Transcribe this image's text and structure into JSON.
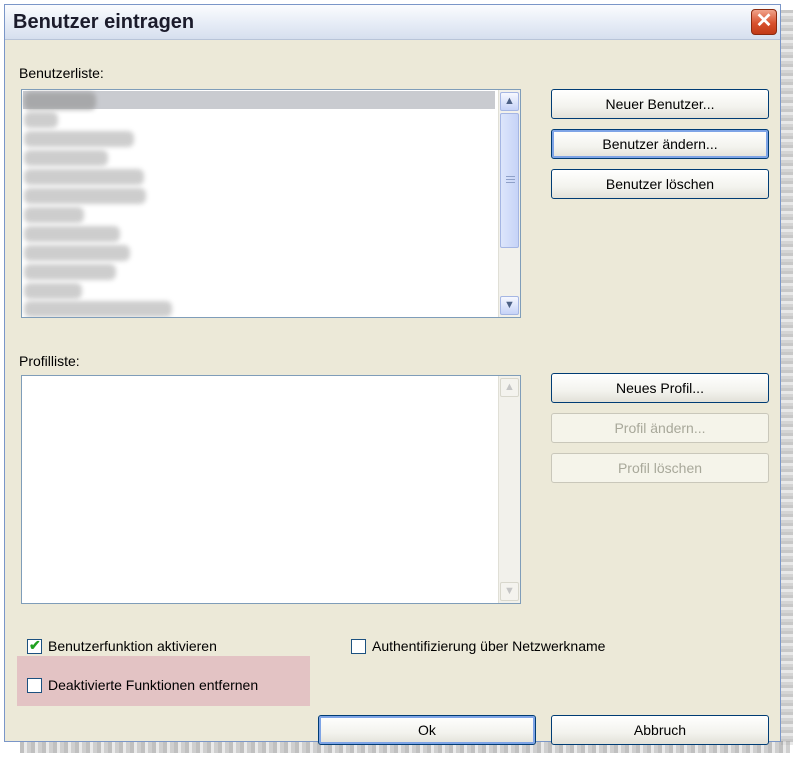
{
  "dialog": {
    "title": "Benutzer eintragen",
    "close_symbol": "✕"
  },
  "users": {
    "label": "Benutzerliste:",
    "buttons": {
      "new": "Neuer Benutzer...",
      "edit": "Benutzer ändern...",
      "delete": "Benutzer löschen"
    }
  },
  "profiles": {
    "label": "Profilliste:",
    "buttons": {
      "new": "Neues Profil...",
      "edit": "Profil ändern...",
      "delete": "Profil löschen"
    }
  },
  "options": {
    "enable_user_function": {
      "label": "Benutzerfunktion aktivieren",
      "checked": true
    },
    "network_auth": {
      "label": "Authentifizierung über Netzwerkname",
      "checked": false
    },
    "remove_disabled": {
      "label": "Deaktivierte Funktionen entfernen",
      "checked": false
    }
  },
  "footer": {
    "ok": "Ok",
    "cancel": "Abbruch"
  },
  "icons": {
    "scroll_up": "▲",
    "scroll_down": "▼",
    "check": "✔"
  },
  "colors": {
    "dialog_bg": "#ece9d8",
    "highlight": "#e3c3c4",
    "close_button": "#d8512e"
  }
}
